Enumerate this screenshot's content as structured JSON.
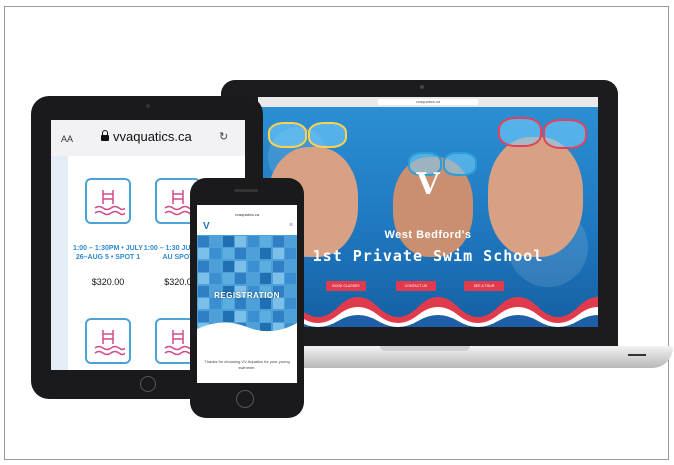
{
  "laptop": {
    "browser_url": "vvaquatics.ca",
    "hero_line1": "West Bedford's",
    "hero_line2": "1st Private Swim School",
    "buttons": [
      "BOOK CLASSES",
      "CONTACT US",
      "SEE A TOUR"
    ]
  },
  "tablet": {
    "text_size_label": "AA",
    "url": "vvaquatics.ca",
    "classes": [
      {
        "title": "1:00 – 1:30PM • JULY 26–AUG 5 • SPOT 1",
        "price": "$320.00"
      },
      {
        "title": "1:00 – 1:30 JULY 26–AU SPOT",
        "price": "$320.0"
      }
    ]
  },
  "phone": {
    "url": "vvaquatics.ca",
    "heading": "REGISTRATION",
    "thanks": "Thanks for choosing VV Aquatics for your young swimmer."
  },
  "colors": {
    "brand_blue": "#1f78c0",
    "accent_red": "#e23a4d"
  }
}
